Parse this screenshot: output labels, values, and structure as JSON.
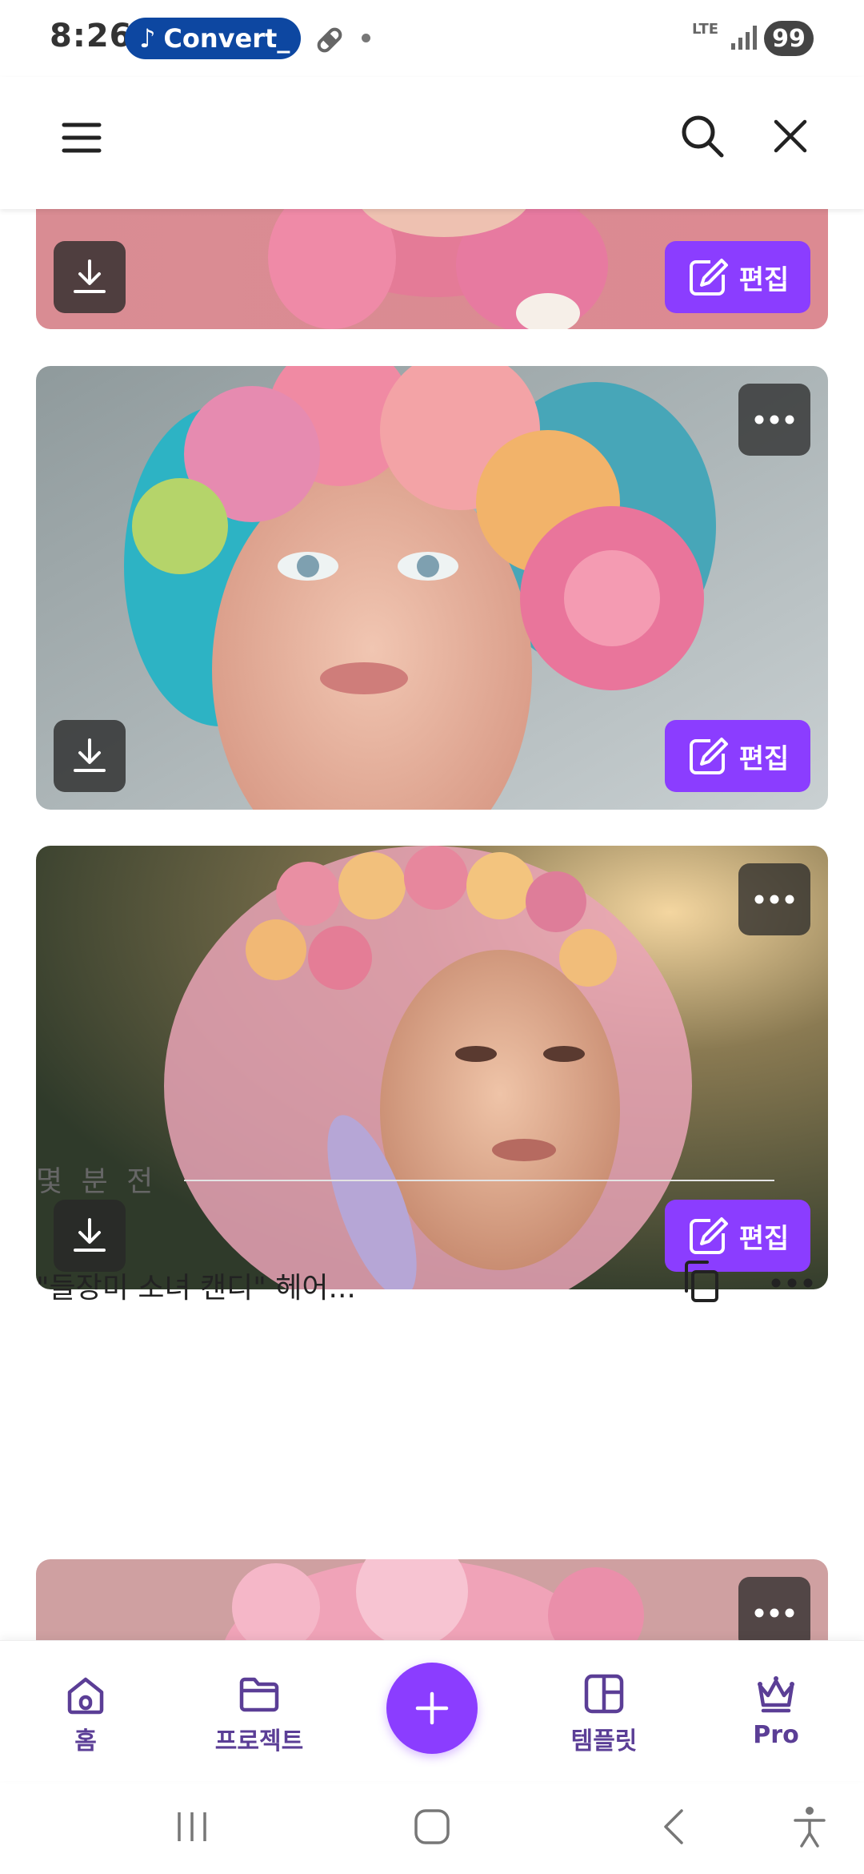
{
  "status_bar": {
    "time": "8:26",
    "notification": "Convert_",
    "network": "LTE",
    "battery": "99"
  },
  "header": {
    "menu_icon": "hamburger-menu-icon",
    "search_icon": "search-icon",
    "close_icon": "close-icon"
  },
  "cards": [
    {
      "download_icon": "download-icon",
      "edit_label": "편집",
      "edit_icon": "pencil-square-icon"
    },
    {
      "download_icon": "download-icon",
      "edit_label": "편집",
      "edit_icon": "pencil-square-icon",
      "more_icon": "more-horizontal-icon"
    },
    {
      "download_icon": "download-icon",
      "edit_label": "편집",
      "edit_icon": "pencil-square-icon",
      "more_icon": "more-horizontal-icon"
    },
    {
      "more_icon": "more-horizontal-icon"
    }
  ],
  "section": {
    "label": "몇 분 전"
  },
  "item": {
    "title": "\"들장미 소녀 캔디\" 헤어...",
    "copy_icon": "copy-icon",
    "more_icon": "more-horizontal-icon"
  },
  "bottom_nav": {
    "items": [
      {
        "label": "홈",
        "icon": "home-icon"
      },
      {
        "label": "프로젝트",
        "icon": "folder-icon"
      },
      {
        "label": "템플릿",
        "icon": "template-icon"
      },
      {
        "label": "Pro",
        "icon": "crown-icon"
      }
    ],
    "fab_icon": "plus-icon"
  },
  "colors": {
    "accent": "#8b3dff",
    "nav_text": "#5b3e96",
    "pill": "#0d47a1"
  }
}
